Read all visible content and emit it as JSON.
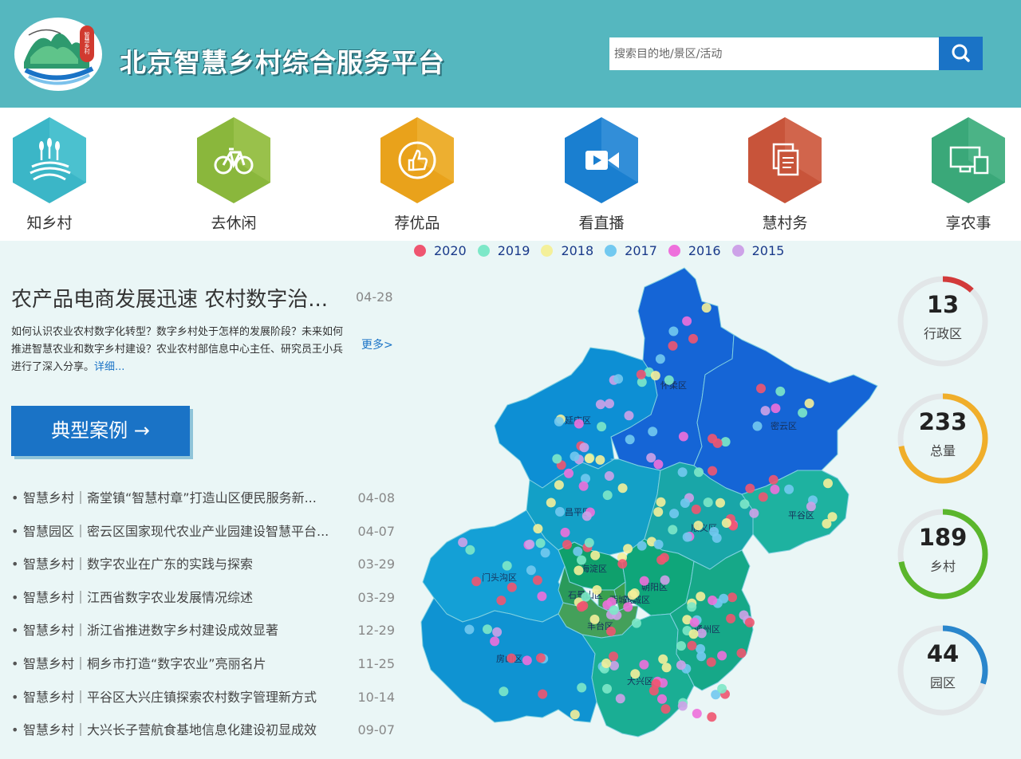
{
  "header": {
    "title": "北京智慧乡村综合服务平台",
    "logo_text": "智慧乡村",
    "search_placeholder": "搜索目的地/景区/活动"
  },
  "nav": [
    {
      "label": "知乡村",
      "icon": "wheat-field-icon",
      "color": "#3bb6c7"
    },
    {
      "label": "去休闲",
      "icon": "bicycle-icon",
      "color": "#8ab73c"
    },
    {
      "label": "荐优品",
      "icon": "thumbs-up-icon",
      "color": "#e9a21b"
    },
    {
      "label": "看直播",
      "icon": "video-camera-icon",
      "color": "#1a7fd0"
    },
    {
      "label": "慧村务",
      "icon": "documents-icon",
      "color": "#c8543a"
    },
    {
      "label": "享农事",
      "icon": "computer-icon",
      "color": "#3aa879"
    }
  ],
  "feature": {
    "title": "农产品电商发展迅速 农村数字治...",
    "date": "04-28",
    "summary": "如何认识农业农村数字化转型？数字乡村处于怎样的发展阶段？未来如何推进智慧农业和数字乡村建设？农业农村部信息中心主任、研究员王小兵进行了深入分享。",
    "detail_link": "详细...",
    "more_link": "更多>"
  },
  "case_button": "典型案例 →",
  "news": [
    {
      "title": "智慧乡村｜斋堂镇“智慧村章”打造山区便民服务新...",
      "date": "04-08"
    },
    {
      "title": "智慧园区｜密云区国家现代农业产业园建设智慧平台...",
      "date": "04-07"
    },
    {
      "title": "智慧乡村｜数字农业在广东的实践与探索",
      "date": "03-29"
    },
    {
      "title": "智慧乡村｜江西省数字农业发展情况综述",
      "date": "03-29"
    },
    {
      "title": "智慧乡村｜浙江省推进数字乡村建设成效显著",
      "date": "12-29"
    },
    {
      "title": "智慧乡村｜桐乡市打造“数字农业”亮丽名片",
      "date": "11-25"
    },
    {
      "title": "智慧乡村｜平谷区大兴庄镇探索农村数字管理新方式",
      "date": "10-14"
    },
    {
      "title": "智慧乡村｜大兴长子营航食基地信息化建设初显成效",
      "date": "09-07"
    }
  ],
  "legend": [
    {
      "year": "2020",
      "color": "#ef5570"
    },
    {
      "year": "2019",
      "color": "#7de8c8"
    },
    {
      "year": "2018",
      "color": "#f4f09a"
    },
    {
      "year": "2017",
      "color": "#72c9f0"
    },
    {
      "year": "2016",
      "color": "#ee70dc"
    },
    {
      "year": "2015",
      "color": "#cda2e8"
    }
  ],
  "map": {
    "districts": [
      {
        "name": "怀柔区",
        "color": "#1565d6"
      },
      {
        "name": "密云区",
        "color": "#1565d6"
      },
      {
        "name": "延庆区",
        "color": "#0d8fd4"
      },
      {
        "name": "昌平区",
        "color": "#13a0c7"
      },
      {
        "name": "顺义区",
        "color": "#19a6a8"
      },
      {
        "name": "平谷区",
        "color": "#1eb2a0"
      },
      {
        "name": "门头沟区",
        "color": "#14a0d6"
      },
      {
        "name": "海淀区",
        "color": "#0fa06c"
      },
      {
        "name": "朝阳区",
        "color": "#0fa67a"
      },
      {
        "name": "石景山区",
        "color": "#2a9a5a"
      },
      {
        "name": "西城区",
        "color": "#3aa04e"
      },
      {
        "name": "东城区",
        "color": "#3aa04e"
      },
      {
        "name": "丰台区",
        "color": "#44a05a"
      },
      {
        "name": "房山区",
        "color": "#0f93d2"
      },
      {
        "name": "大兴区",
        "color": "#1aae94"
      },
      {
        "name": "通州区",
        "color": "#16a888"
      }
    ]
  },
  "stats": [
    {
      "value": "13",
      "label": "行政区",
      "color": "#d23a3a",
      "fraction": 0.12
    },
    {
      "value": "233",
      "label": "总量",
      "color": "#f0ae2a",
      "fraction": 0.72
    },
    {
      "value": "189",
      "label": "乡村",
      "color": "#5bb62c",
      "fraction": 0.72
    },
    {
      "value": "44",
      "label": "园区",
      "color": "#2a86cc",
      "fraction": 0.3
    }
  ]
}
